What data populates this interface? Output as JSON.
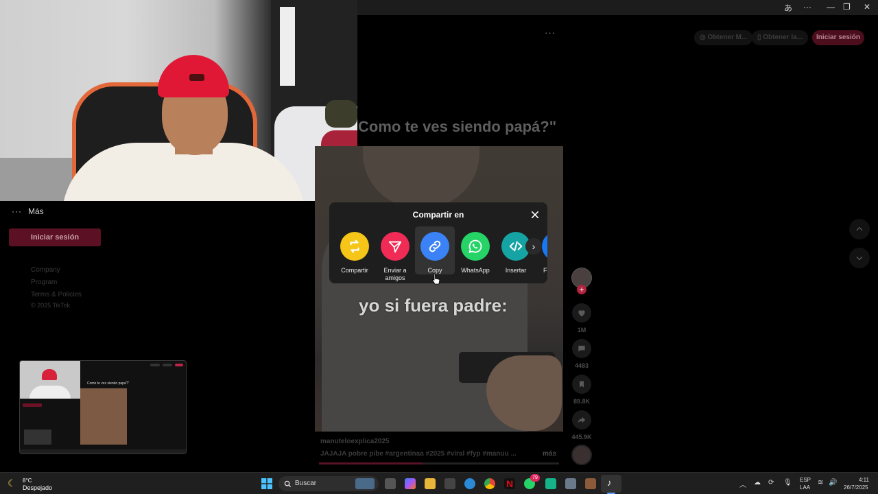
{
  "header": {
    "obtain_app_label": "Obtener M...",
    "obtain_pc_label": "Obtener la...",
    "login_label": "Iniciar sesión"
  },
  "sidebar": {
    "more_label": "Más",
    "login_label": "Iniciar sesión",
    "footer": [
      "Company",
      "Program",
      "Terms & Policies",
      "© 2025 TikTok"
    ]
  },
  "video": {
    "title": "Como te ves siendo papá?\"",
    "caption": "yo si fuera padre:",
    "author": "manuteloexplica2025",
    "description": "JAJAJA pobre pibe #argentinaa #2025 #viral #fyp #manuu ...",
    "more_label": "más",
    "progress": 0.43
  },
  "actions": {
    "likes": "1M",
    "comments": "4483",
    "saves": "89.8K",
    "shares": "445.9K"
  },
  "share_dialog": {
    "title": "Compartir en",
    "items": [
      {
        "label": "Compartir",
        "icon": "repost-icon",
        "color": "#f5c518"
      },
      {
        "label": "Enviar a amigos",
        "icon": "send-icon",
        "color": "#f02b56"
      },
      {
        "label": "Copy",
        "icon": "link-icon",
        "color": "#3b82f6"
      },
      {
        "label": "WhatsApp",
        "icon": "whatsapp-icon",
        "color": "#25d366"
      },
      {
        "label": "Insertar",
        "icon": "embed-icon",
        "color": "#16a3a3"
      },
      {
        "label": "Fa",
        "icon": "facebook-icon",
        "color": "#1877f2"
      }
    ]
  },
  "taskbar": {
    "weather_temp": "8°C",
    "weather_desc": "Despejado",
    "search_label": "Buscar",
    "whatsapp_badge": "79",
    "lang_1": "ESP",
    "lang_2": "LAA",
    "time": "4:11",
    "date": "26/7/2025"
  }
}
